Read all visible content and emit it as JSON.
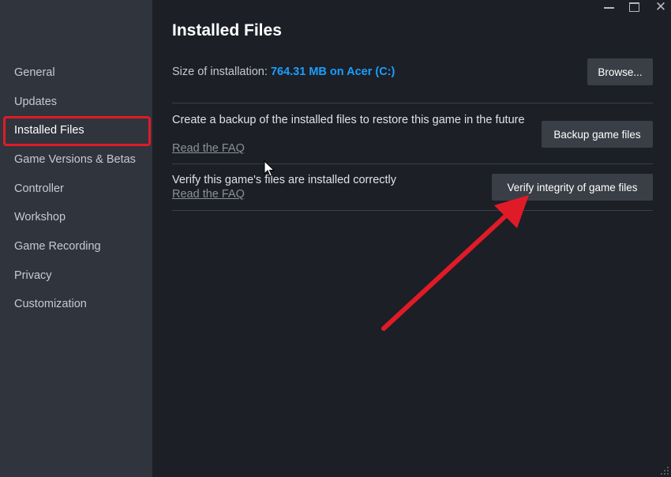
{
  "header": {
    "title": "Installed Files"
  },
  "sidebar": {
    "items": [
      {
        "label": "General"
      },
      {
        "label": "Updates"
      },
      {
        "label": "Installed Files"
      },
      {
        "label": "Game Versions & Betas"
      },
      {
        "label": "Controller"
      },
      {
        "label": "Workshop"
      },
      {
        "label": "Game Recording"
      },
      {
        "label": "Privacy"
      },
      {
        "label": "Customization"
      }
    ],
    "active": "Installed Files"
  },
  "installation": {
    "size_label": "Size of installation:",
    "size_value": "764.31 MB on Acer (C:)",
    "browse_label": "Browse..."
  },
  "backup": {
    "description": "Create a backup of the installed files to restore this game in the future",
    "faq_label": "Read the FAQ",
    "button_label": "Backup game files"
  },
  "verify": {
    "description": "Verify this game's files are installed correctly",
    "faq_label": "Read the FAQ",
    "button_label": "Verify integrity of game files"
  },
  "window_controls": {
    "close_glyph": "✕"
  },
  "colors": {
    "accent": "#1a9fff",
    "highlight": "#e01b27",
    "sidebar_bg": "#30343d",
    "main_bg": "#1c1f26",
    "button_bg": "#3a3e47"
  },
  "icons": [
    "minimize-icon",
    "maximize-icon",
    "close-icon",
    "mouse-cursor-icon",
    "annotation-arrow-icon",
    "resize-grip-icon"
  ]
}
